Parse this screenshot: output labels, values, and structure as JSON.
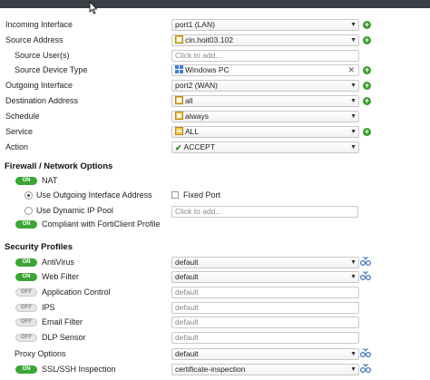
{
  "policy": {
    "incoming_interface": {
      "label": "Incoming Interface",
      "value": "port1 (LAN)"
    },
    "source_address": {
      "label": "Source Address",
      "value": "cln.hoit03.102"
    },
    "source_users": {
      "label": "Source User(s)",
      "placeholder": "Click to add..."
    },
    "source_device_type": {
      "label": "Source Device Type",
      "value": "Windows PC"
    },
    "outgoing_interface": {
      "label": "Outgoing Interface",
      "value": "port2 (WAN)"
    },
    "destination_address": {
      "label": "Destination Address",
      "value": "all"
    },
    "schedule": {
      "label": "Schedule",
      "value": "always"
    },
    "service": {
      "label": "Service",
      "value": "ALL"
    },
    "action": {
      "label": "Action",
      "value": "ACCEPT"
    }
  },
  "firewall": {
    "title": "Firewall / Network Options",
    "nat_label": "NAT",
    "use_outgoing_label": "Use Outgoing Interface Address",
    "fixed_port_label": "Fixed Port",
    "use_dynamic_label": "Use Dynamic IP Pool",
    "dynamic_placeholder": "Click to add...",
    "compliant_label": "Compliant with FortiClient Profile"
  },
  "security": {
    "title": "Security Profiles",
    "profiles": [
      {
        "label": "AntiVirus",
        "state": "ON",
        "value": "default",
        "enabled": true
      },
      {
        "label": "Web Filter",
        "state": "ON",
        "value": "default",
        "enabled": true
      },
      {
        "label": "Application Control",
        "state": "OFF",
        "value": "default",
        "enabled": false
      },
      {
        "label": "IPS",
        "state": "OFF",
        "value": "default",
        "enabled": false
      },
      {
        "label": "Email Filter",
        "state": "OFF",
        "value": "default",
        "enabled": false
      },
      {
        "label": "DLP Sensor",
        "state": "OFF",
        "value": "default",
        "enabled": false
      }
    ],
    "proxy_options": {
      "label": "Proxy Options",
      "value": "default"
    },
    "ssl_inspection": {
      "label": "SSL/SSH Inspection",
      "state": "ON",
      "value": "certificate-inspection"
    }
  },
  "toggle_on": "ON",
  "toggle_off": "OFF",
  "colors": {
    "toggle_on": "#3aa635",
    "add_button": "#3a9e2c",
    "topbar": "#3a3f46"
  }
}
